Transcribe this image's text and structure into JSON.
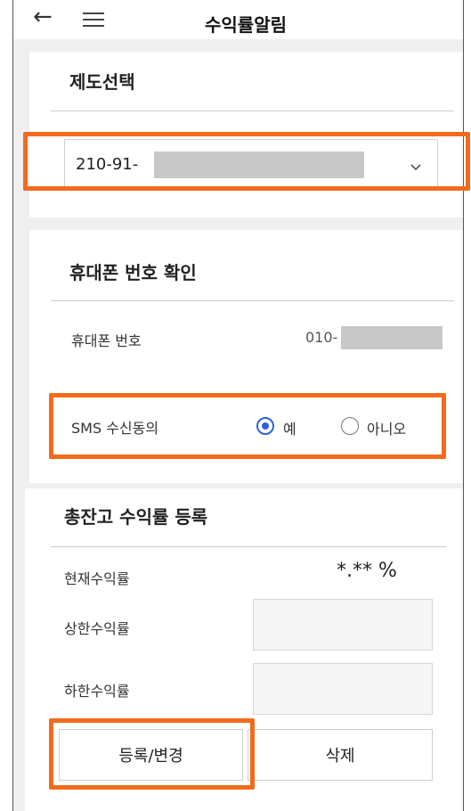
{
  "header": {
    "title": "수익률알림"
  },
  "plan_section": {
    "title": "제도선택",
    "account_prefix": "210-91-"
  },
  "phone_section": {
    "title": "휴대폰 번호 확인",
    "phone_label": "휴대폰 번호",
    "phone_prefix": "010-",
    "sms_label": "SMS 수신동의",
    "option_yes": "예",
    "option_no": "아니오",
    "selected": "예"
  },
  "return_section": {
    "title": "총잔고 수익률 등록",
    "current_label": "현재수익률",
    "current_value": "*.** %",
    "upper_label": "상한수익률",
    "lower_label": "하한수익률",
    "register_button": "등록/변경",
    "delete_button": "삭제"
  },
  "colors": {
    "highlight": "#f26b1d",
    "radio_selected": "#2b63d8"
  }
}
